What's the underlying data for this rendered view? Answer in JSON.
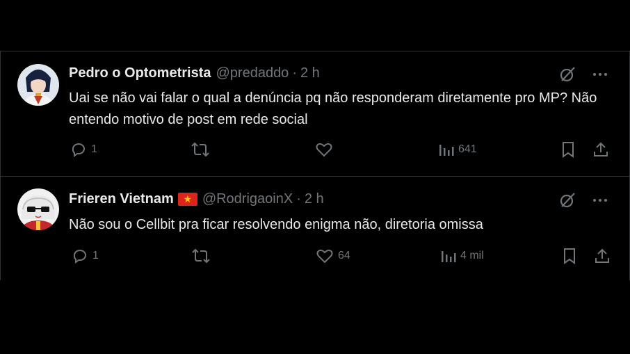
{
  "tweets": [
    {
      "name": "Pedro o Optometrista",
      "handle": "@predaddo",
      "separator": "·",
      "time": "2 h",
      "text": "Uai se não vai falar o qual a denúncia pq não responderam diretamente pro MP? Não entendo motivo de post em rede social",
      "replies": "1",
      "retweets": "",
      "likes": "",
      "views": "641"
    },
    {
      "name": "Frieren Vietnam",
      "flag_icon": "vietnam-flag-icon",
      "flag_star": "★",
      "handle": "@RodrigaoinX",
      "separator": "·",
      "time": "2 h",
      "text": "Não sou o Cellbit pra ficar resolvendo enigma não, diretoria omissa",
      "replies": "1",
      "retweets": "",
      "likes": "64",
      "views": "4 mil"
    }
  ],
  "icons": {
    "grok": "grok-icon",
    "more": "more-icon",
    "reply": "reply-icon",
    "retweet": "retweet-icon",
    "like": "heart-icon",
    "views": "views-icon",
    "bookmark": "bookmark-icon",
    "share": "share-icon"
  },
  "colors": {
    "background": "#000000",
    "text": "#e7e9ea",
    "muted": "#71767b",
    "border": "#2f3336"
  }
}
